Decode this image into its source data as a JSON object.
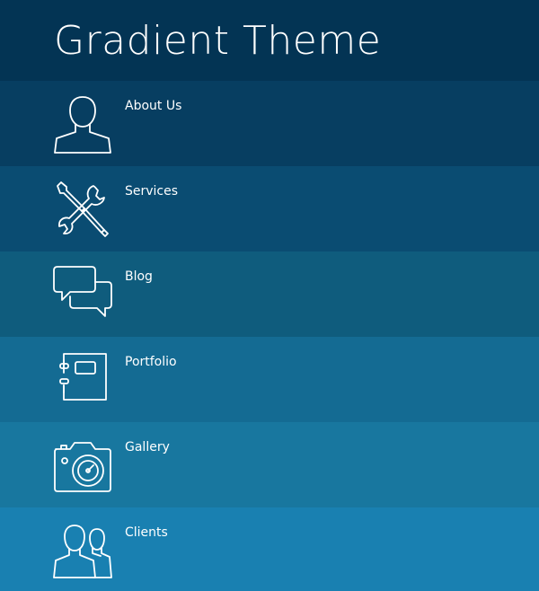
{
  "header": {
    "title": "Gradient Theme"
  },
  "menu": {
    "items": [
      {
        "label": "About Us",
        "icon": "person-icon"
      },
      {
        "label": "Services",
        "icon": "tools-icon"
      },
      {
        "label": "Blog",
        "icon": "chat-bubbles-icon"
      },
      {
        "label": "Portfolio",
        "icon": "notebook-icon"
      },
      {
        "label": "Gallery",
        "icon": "camera-icon"
      },
      {
        "label": "Clients",
        "icon": "people-icon"
      }
    ]
  },
  "colors": {
    "header_bg": "#033454",
    "row_backgrounds": [
      "#073e61",
      "#0a4c72",
      "#0f5c7d",
      "#146b93",
      "#18779f",
      "#1980b1"
    ],
    "text": "#ffffff"
  }
}
